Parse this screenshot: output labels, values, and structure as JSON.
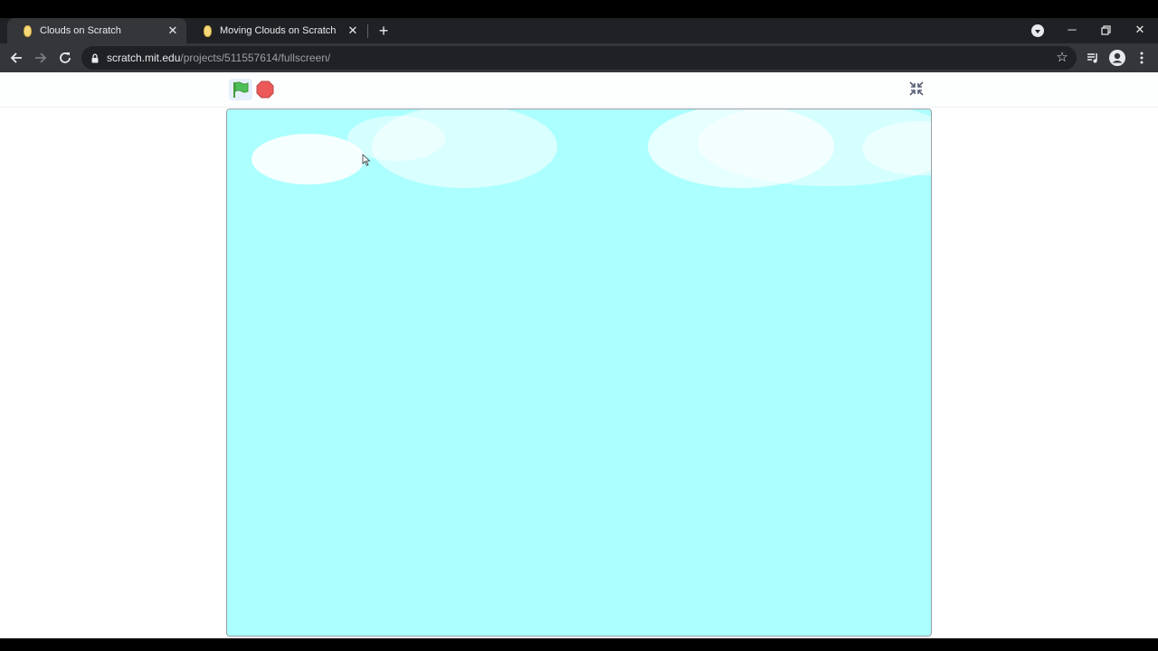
{
  "browser": {
    "tabs": [
      {
        "title": "Clouds on Scratch",
        "active": true,
        "favicon": "scratch-cat-icon"
      },
      {
        "title": "Moving Clouds on Scratch",
        "active": false,
        "favicon": "scratch-cat-icon"
      }
    ],
    "address": {
      "host": "scratch.mit.edu",
      "path": "/projects/511557614/fullscreen/"
    },
    "icons": {
      "back": "arrow-left-icon",
      "forward": "arrow-right-icon",
      "reload": "reload-icon",
      "lock": "lock-icon",
      "bookmark": "star-icon",
      "media": "media-control-icon",
      "profile": "profile-icon",
      "menu": "kebab-menu-icon",
      "new_tab": "plus-icon",
      "tab_search": "tab-search-icon",
      "minimize": "minimize-icon",
      "restore": "restore-icon",
      "close": "close-icon"
    }
  },
  "player": {
    "controls": {
      "green_flag": "green-flag-icon",
      "stop": "stop-sign-icon",
      "unfullscreen": "unfullscreen-icon"
    },
    "stage": {
      "background_color": "#abffff",
      "cloud_color": "#ffffff"
    }
  },
  "colors": {
    "tab_strip": "#202124",
    "toolbar": "#35363a",
    "flag_green": "#4cbf56",
    "stop_red": "#ec5959"
  }
}
